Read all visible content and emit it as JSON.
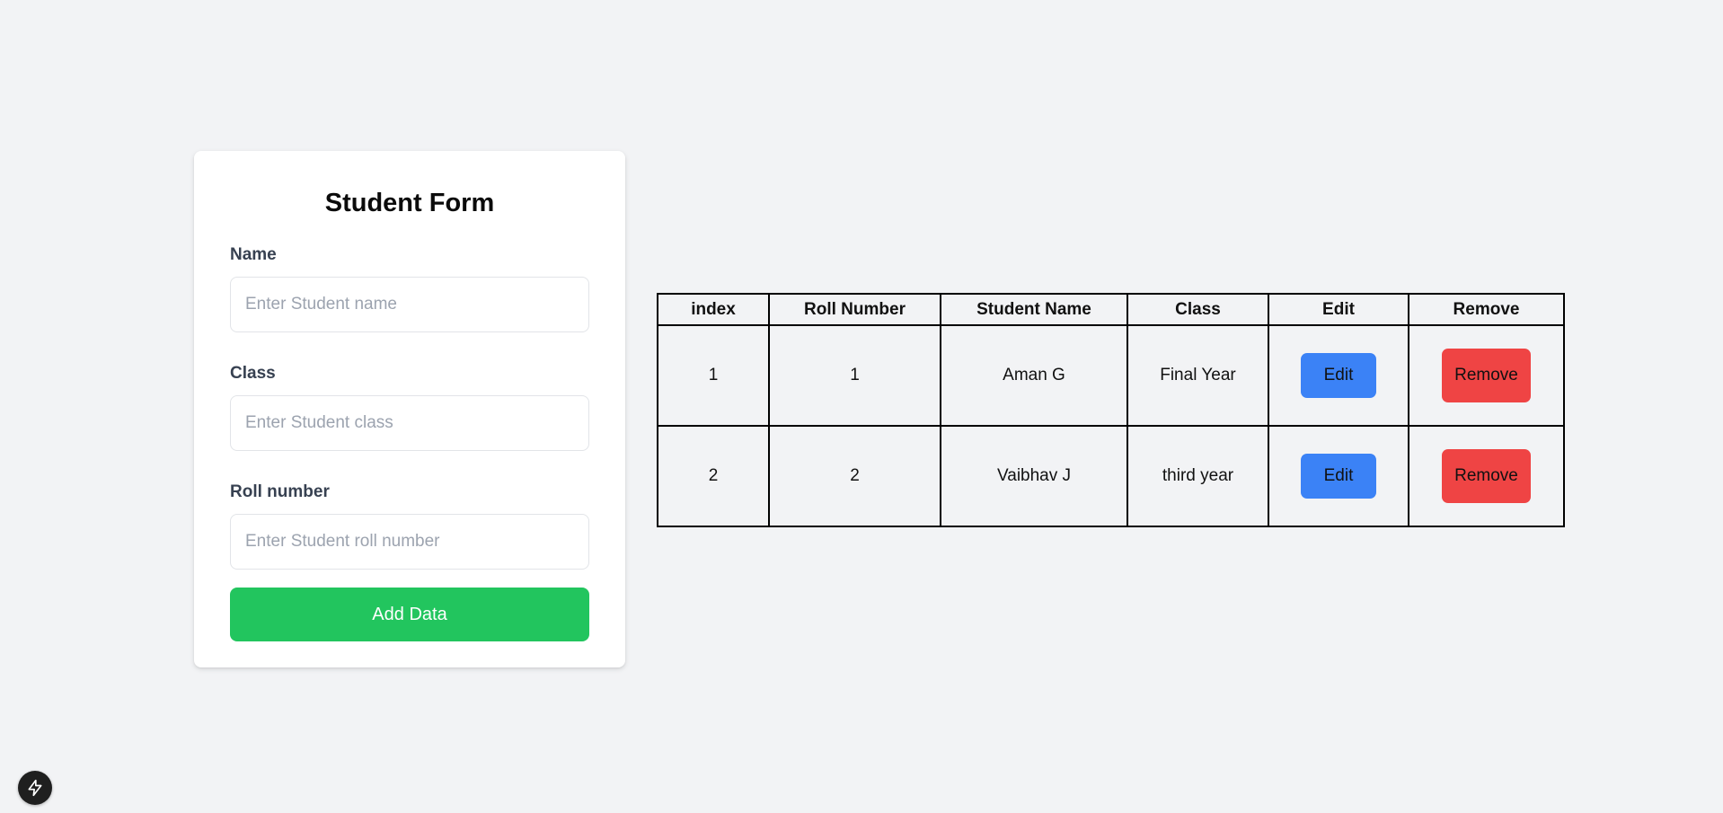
{
  "form": {
    "title": "Student Form",
    "name_label": "Name",
    "name_placeholder": "Enter Student name",
    "name_value": "",
    "class_label": "Class",
    "class_placeholder": "Enter Student class",
    "class_value": "",
    "roll_label": "Roll number",
    "roll_placeholder": "Enter Student roll number",
    "roll_value": "",
    "submit_label": "Add Data"
  },
  "table": {
    "headers": [
      "index",
      "Roll Number",
      "Student Name",
      "Class",
      "Edit",
      "Remove"
    ],
    "rows": [
      {
        "index": "1",
        "roll": "1",
        "name": "Aman G",
        "class": "Final Year",
        "edit_label": "Edit",
        "remove_label": "Remove"
      },
      {
        "index": "2",
        "roll": "2",
        "name": "Vaibhav J",
        "class": "third year",
        "edit_label": "Edit",
        "remove_label": "Remove"
      }
    ]
  },
  "colors": {
    "background": "#f2f3f5",
    "add_button": "#22c55e",
    "edit_button": "#3b82f6",
    "remove_button": "#ef4444"
  },
  "icons": {
    "dev_badge": "lightning-bolt-icon"
  }
}
